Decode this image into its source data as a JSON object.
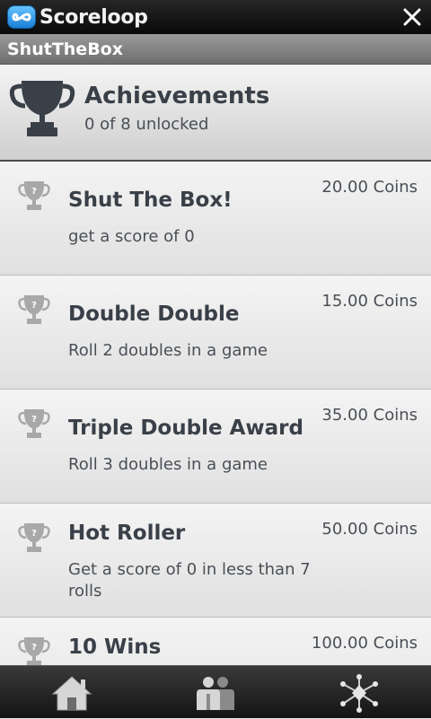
{
  "app": {
    "brand_name": "Scoreloop",
    "game_title": "ShutTheBox"
  },
  "header": {
    "title": "Achievements",
    "subtitle": "0 of 8 unlocked"
  },
  "achievements": [
    {
      "title": "Shut The Box!",
      "description": "get a score of 0",
      "reward": "20.00 Coins"
    },
    {
      "title": "Double Double",
      "description": "Roll 2 doubles in a game",
      "reward": "15.00 Coins"
    },
    {
      "title": "Triple Double Award",
      "description": "Roll 3 doubles in a game",
      "reward": "35.00 Coins"
    },
    {
      "title": "Hot Roller",
      "description": "Get a score of 0 in less than 7 rolls",
      "reward": "50.00 Coins"
    },
    {
      "title": "10 Wins",
      "description": "",
      "reward": "100.00 Coins"
    }
  ],
  "icons": {
    "logo": "scoreloop-logo-icon",
    "close": "close-icon",
    "header_trophy": "trophy-icon",
    "locked_achievement": "locked-trophy-icon",
    "nav_home": "home-icon",
    "nav_friends": "friends-icon",
    "nav_more": "network-icon"
  },
  "colors": {
    "brand_blue": "#3399ee",
    "header_text": "#3a4048",
    "topbar": "#1a1a1a"
  }
}
